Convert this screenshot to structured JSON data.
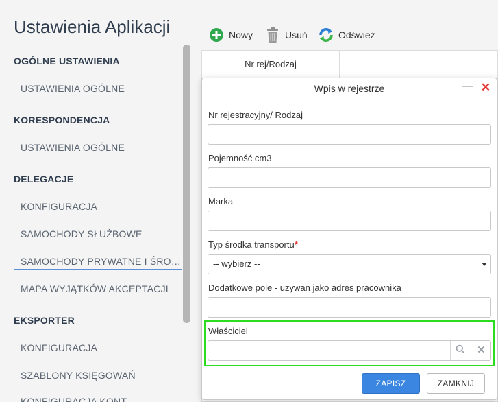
{
  "app": {
    "title": "Ustawienia Aplikacji"
  },
  "sidebar": {
    "sections": [
      {
        "title": "OGÓLNE USTAWIENIA",
        "items": [
          "USTAWIENIA OGÓLNE"
        ]
      },
      {
        "title": "KORESPONDENCJA",
        "items": [
          "USTAWIENIA OGÓLNE"
        ]
      },
      {
        "title": "DELEGACJE",
        "items": [
          "KONFIGURACJA",
          "SAMOCHODY SŁUŻBOWE",
          "SAMOCHODY PRYWATNE I ŚRODKI TRANSPORTU",
          "MAPA WYJĄTKÓW AKCEPTACJI"
        ]
      },
      {
        "title": "EKSPORTER",
        "items": [
          "KONFIGURACJA",
          "SZABLONY KSIĘGOWAŃ",
          "KONFIGURACJA KONT"
        ]
      }
    ],
    "active_item": "SAMOCHODY PRYWATNE I ŚRODKI TRANSPORTU"
  },
  "toolbar": {
    "new_label": "Nowy",
    "delete_label": "Usuń",
    "refresh_label": "Odśwież"
  },
  "grid": {
    "columns": [
      "Nr rej/Rodzaj"
    ]
  },
  "dialog": {
    "title": "Wpis w rejestrze",
    "fields": {
      "registration": {
        "label": "Nr rejestracyjny/ Rodzaj",
        "value": ""
      },
      "capacity": {
        "label": "Pojemność cm3",
        "value": ""
      },
      "brand": {
        "label": "Marka",
        "value": ""
      },
      "transport_type": {
        "label": "Typ środka transportu",
        "required_mark": "*",
        "selected": "-- wybierz --"
      },
      "extra": {
        "label": "Dodatkowe pole - uzywan jako adres pracownika",
        "value": ""
      },
      "owner": {
        "label": "Właściciel",
        "value": ""
      }
    },
    "buttons": {
      "save": "ZAPISZ",
      "close": "ZAMKNIJ"
    }
  },
  "colors": {
    "accent": "#3a86e0",
    "highlight": "#2bdd1e",
    "close": "#e53935",
    "add": "#2fa84f",
    "refresh_blue": "#2a7fd4",
    "refresh_green": "#3bb54a"
  }
}
